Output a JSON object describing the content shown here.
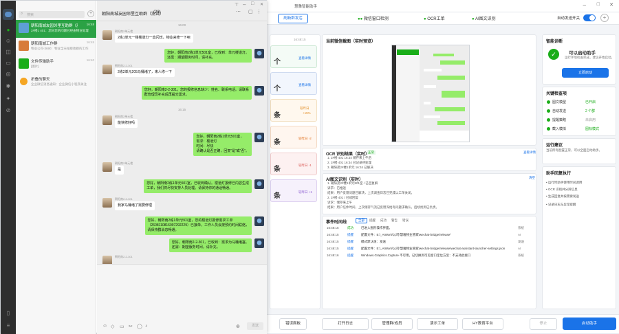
{
  "bg_app": {
    "title": "慧雅智能助手",
    "top_button": "刷新群发活",
    "tabs": [
      {
        "label": "微信窗口检测"
      },
      {
        "label": "OCR工单"
      },
      {
        "label": "AI图文识别"
      }
    ],
    "auto_mode_label": "自动发送开关",
    "time_label": "16:48:15",
    "monitor_title": "当前微信截图（实时预览）",
    "stats": [
      {
        "value": "个",
        "link": "查看详情"
      },
      {
        "value": "个",
        "link": "查看详情"
      },
      {
        "value": "条",
        "link": "较昨日",
        "delta": "+15%"
      },
      {
        "value": "条",
        "link": "较昨日 -2"
      },
      {
        "value": "条",
        "link": "较昨日 -1"
      },
      {
        "value": "条",
        "link": "较昨日 +1"
      }
    ],
    "ocr": {
      "title": "OCR 识别结果（实时）",
      "badge": "正常",
      "link": "查看详情",
      "lines": [
        "1. 2#楼 401   16:34   储存来上午后",
        "2. 2#楼 401   16:34   已记录待处理",
        "3. 朝阳苑2#楼1单元   16:34   已解决"
      ]
    },
    "ai": {
      "title": "AI图文识别（实时）",
      "link": "清空",
      "lines": [
        "1. 朝阳苑2#楼1单元501室 / 已回复解",
        "  诉求：已推送",
        "  结果：用户反馈问题已解决，上次调查日志已完成以工单关闭。",
        "2. 2#楼 401 / 已成回复",
        "  诉求：储存来上午",
        "  结果：用户信件时间，上次储存气流已反馈深给有问题求确认，后续找到已负责。"
      ]
    },
    "events": {
      "title": "事件时间线",
      "filters": [
        "全部",
        "提醒",
        "成功",
        "警告",
        "错误"
      ],
      "rows": [
        {
          "time": "16:48:15",
          "tag": "成功",
          "text": "已进入图形操作界面。",
          "src": "系统"
        },
        {
          "time": "16:48:15",
          "tag": "提醒",
          "text": "配置文件：E:\\_AIWork\\公司\\慧雅物业管家\\wechat-bridge\\release\\",
          "src": "AI"
        },
        {
          "time": "16:48:15",
          "tag": "提醒",
          "text": "模式默认值：发送",
          "src": "发送"
        },
        {
          "time": "16:48:15",
          "tag": "提醒",
          "text": "配置文件：E:\\_AIWork\\公司\\慧雅物业管家\\wechat-bridge\\release\\wechat-assistant-launcher-settings.json",
          "src": "AI"
        },
        {
          "time": "16:48:16",
          "tag": "提醒",
          "text": "Windows.Graphics.Capture 不可用，已切换到可见窗口定位方案：不支持此接口",
          "src": "系统"
        }
      ]
    },
    "diagnosis": {
      "title": "智能诊断",
      "status": "可以启动助手",
      "desc": "运行环境检查完成，建议开始启动。",
      "button": "立即启动"
    },
    "checks": {
      "title": "关键检查项",
      "items": [
        {
          "label": "图文模型",
          "value": "已开启"
        },
        {
          "label": "自动发送",
          "value": "2 个群"
        },
        {
          "label": "提醒策略",
          "value": "未启用"
        },
        {
          "label": "截入模拟",
          "value": "图标模式"
        }
      ]
    },
    "suggest": {
      "title": "运行建议",
      "text": "当前所有配置正常，可以全面启动助手。"
    },
    "steps": {
      "title": "助手回复执行",
      "items": [
        "• 运行时助手使用时间调用",
        "• OCR 识别并分辨信息",
        "• 生成回复并按需要发送",
        "• 记录日志与异常提醒"
      ]
    },
    "bottom": {
      "buttons": [
        "错误面板",
        "打开日志",
        "管理群/成员",
        "演示工单",
        "HY教育平台"
      ],
      "stop": "停止",
      "start": "启动助手"
    }
  },
  "wechat": {
    "search_placeholder": "搜索",
    "chats": [
      {
        "name": "朝阳南城友园邻里互助群（测试）",
        "preview": "2#楼1 401：您好您的问题已经由物业处理",
        "time": "16:48"
      },
      {
        "name": "朝阳南城工作群",
        "preview": "物业公司-3690：物业全天候接收群的工作",
        "time": "16:45"
      },
      {
        "name": "文件传输助手",
        "preview": "[图片]",
        "time": "16:40"
      },
      {
        "name": "折叠的聊天",
        "preview": "企业微信消息通知：企业微信小程序关注",
        "time": ""
      }
    ],
    "chat_title": "朝阳南城友园邻里互助群（测试）",
    "member_count": "(28)",
    "times": [
      "16:00",
      "16:15"
    ],
    "messages": [
      {
        "dir": "in",
        "sender": "朝阳南2单元楼 ",
        "text": "2栋1单元一楼楼道灯一直闪烁，物业来修一下吧"
      },
      {
        "dir": "out",
        "sender": "",
        "text": "您好，朝阳南2栋1单元501室，已收到：单元楼道灯。\n还需：期望服务时间，请补充。"
      },
      {
        "dir": "in",
        "sender": "朝阳南2-2-301",
        "text": "2栋2单元205马桶堵了，来人修一下"
      },
      {
        "dir": "out",
        "sender": "",
        "text": "您好，朝阳南2-2-301，您的报修信息缺少：姓名、联系电话。请联系\n群管理员补充后再提交需求。"
      },
      {
        "dir": "in",
        "sender": "朝阳南2单元楼 ",
        "text": "能快修好吗"
      },
      {
        "dir": "out",
        "sender": "",
        "text": "您好，朝阳南2栋1单元501室，\n需求：楼道灯\n时间：尽快\n请确认是否正确，回复“是”或“否”。"
      },
      {
        "dir": "in",
        "sender": "朝阳南2单元楼 ",
        "text": "是"
      },
      {
        "dir": "out",
        "sender": "",
        "text": "您好，朝阳南2栋1单元501室，已收到确认。楼道灯报修已内容生成\n工单，我们将尽快安排人员处理。请保持你的通话畅通。"
      },
      {
        "dir": "in",
        "sender": "朝阳南2-2-301",
        "text": "我家马桶堵了需要修理"
      },
      {
        "dir": "out",
        "sender": "",
        "text": "您好，朝阳南2栋1单元501室，您的楼道灯报修需求工单\n（2608110816097292229）已接单，工作人员会按预约时间联络，\n请保持群消息畅通。"
      },
      {
        "dir": "out",
        "sender": "",
        "text": "您好，朝阳南2-2-301，已收到：需求为马桶堵塞。\n还需：期望服务时间，请补充。"
      },
      {
        "dir": "in",
        "sender": "朝阳南2-2-301",
        "text": ""
      }
    ],
    "send_button": "发送"
  }
}
